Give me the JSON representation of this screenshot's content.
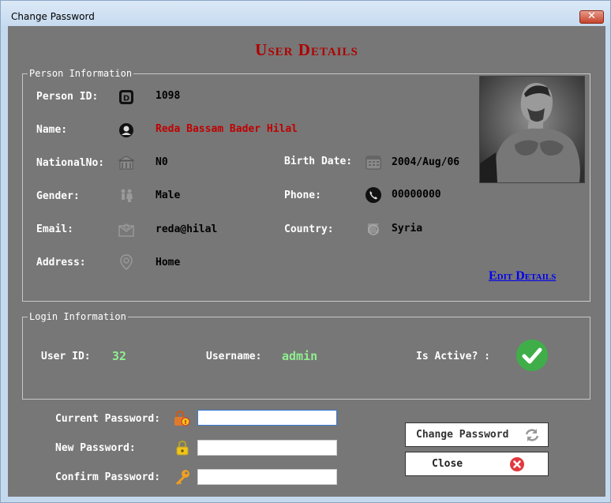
{
  "window": {
    "title": "Change Password",
    "close_glyph": "✕"
  },
  "page_title": "User Details",
  "person": {
    "legend": "Person Information",
    "person_id_label": "Person ID:",
    "person_id": "1098",
    "name_label": "Name:",
    "name": "Reda Bassam Bader Hilal",
    "national_no_label": "NationalNo:",
    "national_no": "N0",
    "birth_date_label": "Birth Date:",
    "birth_date": "2004/Aug/06",
    "gender_label": "Gender:",
    "gender": "Male",
    "phone_label": "Phone:",
    "phone": "00000000",
    "email_label": "Email:",
    "email": "reda@hilal",
    "country_label": "Country:",
    "country": "Syria",
    "address_label": "Address:",
    "address": "Home",
    "edit_link": "Edit Details"
  },
  "login": {
    "legend": "Login Information",
    "user_id_label": "User ID:",
    "user_id": "32",
    "username_label": "Username:",
    "username": "admin",
    "is_active_label": "Is Active? :",
    "is_active": true
  },
  "password": {
    "current_label": "Current Password:",
    "current_value": "",
    "new_label": "New Password:",
    "new_value": "",
    "confirm_label": "Confirm Password:",
    "confirm_value": ""
  },
  "buttons": {
    "change_password": "Change Password",
    "close": "Close"
  },
  "colors": {
    "accent_red": "#b00000",
    "link_blue": "#0000ee",
    "value_green": "#90ee90",
    "active_green": "#3fae49"
  }
}
